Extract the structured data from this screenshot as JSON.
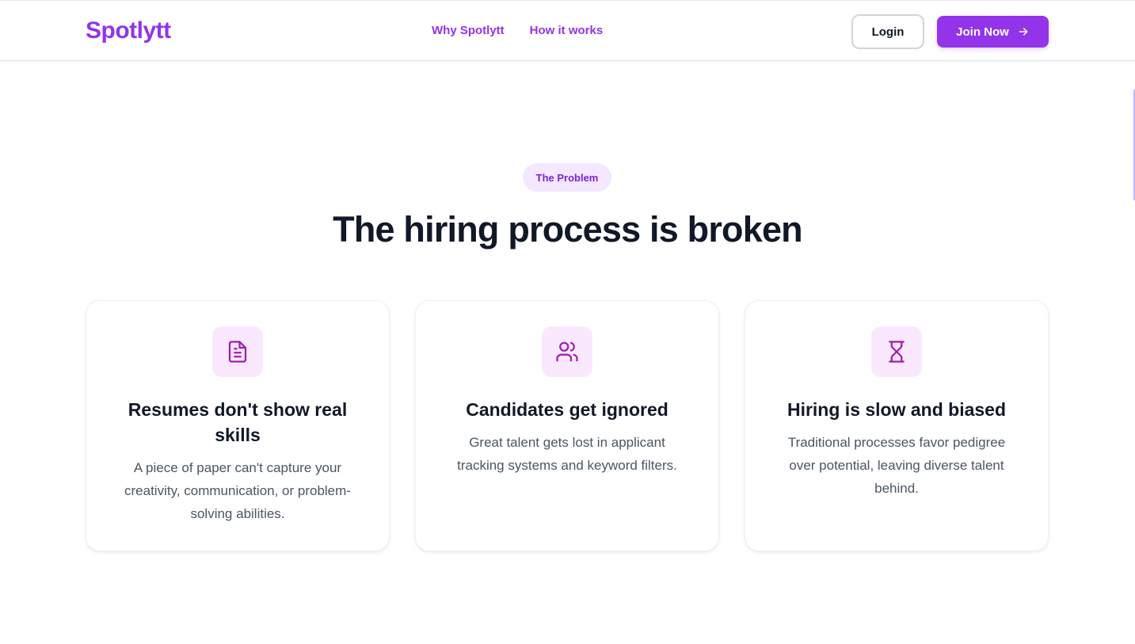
{
  "header": {
    "logo": "Spotlytt",
    "nav": [
      {
        "label": "Why Spotlytt"
      },
      {
        "label": "How it works"
      }
    ],
    "login_label": "Login",
    "join_label": "Join Now"
  },
  "problem": {
    "badge": "The Problem",
    "headline": "The hiring process is broken",
    "cards": [
      {
        "icon": "document-icon",
        "title": "Resumes don't show real skills",
        "text": "A piece of paper can't capture your creativity, communication, or problem-solving abilities."
      },
      {
        "icon": "users-icon",
        "title": "Candidates get ignored",
        "text": "Great talent gets lost in applicant tracking systems and keyword filters."
      },
      {
        "icon": "hourglass-icon",
        "title": "Hiring is slow and biased",
        "text": "Traditional processes favor pedigree over potential, leaving diverse talent behind."
      }
    ]
  },
  "colors": {
    "brand": "#9333ea",
    "badge_bg": "#f3e8ff",
    "icon_bg": "#fae8ff",
    "heading": "#111827",
    "body_text": "#4b5563"
  }
}
